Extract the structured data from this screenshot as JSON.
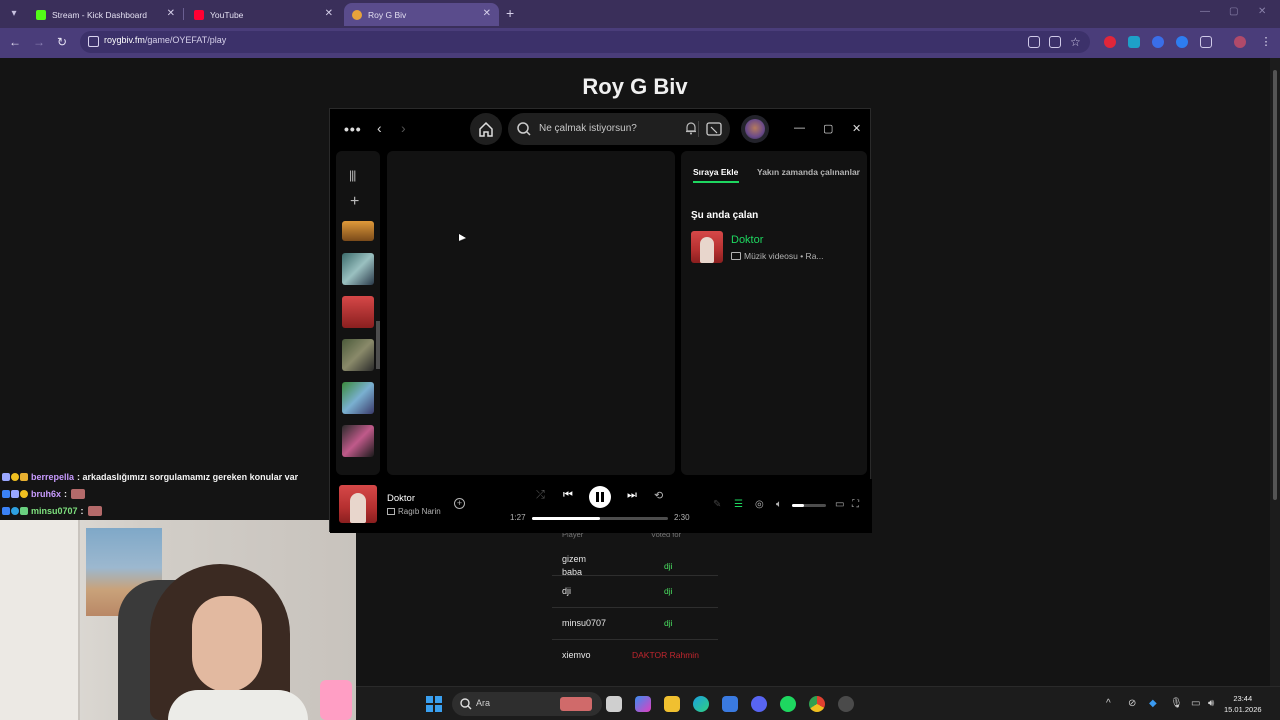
{
  "browser": {
    "tabs": [
      {
        "title": "Stream - Kick Dashboard",
        "favicon_color": "#53fc18"
      },
      {
        "title": "YouTube",
        "favicon_color": "#ff0033"
      },
      {
        "title": "Roy G Biv",
        "favicon_color": "#e8a33b"
      }
    ],
    "new_tab": "+",
    "url_host": "roygbiv.fm",
    "url_path": "/game/OYEFAT/play"
  },
  "page": {
    "title": "Roy G Biv",
    "vote_table": {
      "col_player": "Player",
      "col_voted": "Voted for",
      "rows": [
        {
          "player": "gizem baba",
          "voted": "dji",
          "correct": true
        },
        {
          "player": "dji",
          "voted": "dji",
          "correct": true
        },
        {
          "player": "minsu0707",
          "voted": "dji",
          "correct": true
        },
        {
          "player": "xiemvo",
          "voted": "DAKTOR Rahmin",
          "correct": false
        }
      ]
    }
  },
  "chat": {
    "messages": [
      {
        "user": "berrepella",
        "user_color": "#c89bff",
        "message": ": arkadaslığımızı sorgulamamız gereken konular var"
      },
      {
        "user": "bruh6x",
        "user_color": "#c89bff",
        "message": ":"
      },
      {
        "user": "minsu0707",
        "user_color": "#7ee07e",
        "message": ":"
      }
    ]
  },
  "spotify": {
    "search_placeholder": "Ne çalmak istiyorsun?",
    "queue": {
      "tab_queue": "Sıraya Ekle",
      "tab_recent": "Yakın zamanda çalınanlar",
      "now_playing_heading": "Şu anda çalan",
      "track_title": "Doktor",
      "track_sub": "Müzik videosu • Ra..."
    },
    "player": {
      "title": "Doktor",
      "artist": "Ragıb Narin",
      "elapsed": "1:27",
      "duration": "2:30",
      "progress": 0.5,
      "volume": 0.35
    },
    "accent": "#1ed760"
  },
  "taskbar": {
    "search_label": "Ara",
    "time": "23:44",
    "date": "15.01.2026"
  }
}
